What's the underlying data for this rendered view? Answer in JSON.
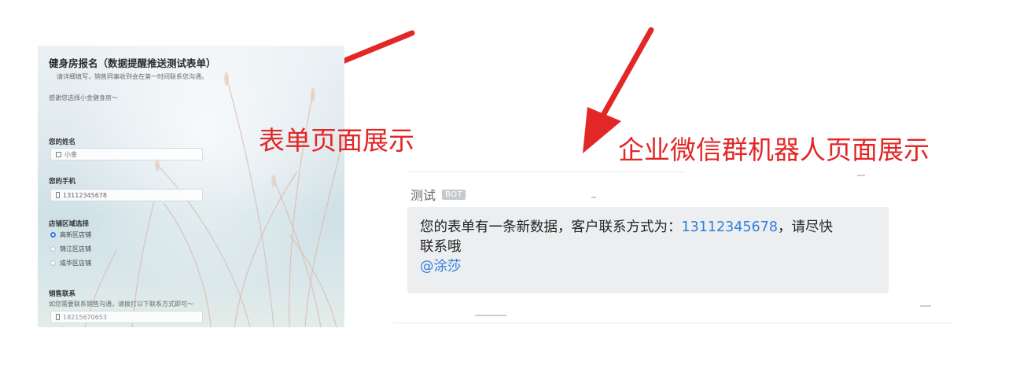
{
  "form": {
    "title": "健身房报名（数据提醒推送测试表单）",
    "description": "请详细填写，销售同事收到会在第一时间联系您沟通。",
    "thanks": "感谢您选择小金健身房～",
    "name_label": "您的姓名",
    "name_value": "小金",
    "phone_label": "您的手机",
    "phone_value": "13112345678",
    "store_label": "店铺区域选择",
    "store_options": [
      "高新区店铺",
      "锦江区店铺",
      "成华区店铺"
    ],
    "store_selected": "高新区店铺",
    "sales_label": "销售联系",
    "sales_hint": "如您需要联系销售沟通，请拨打以下联系方式即可～",
    "sales_phone": "18215670653"
  },
  "captions": {
    "form_caption": "表单页面展示",
    "bot_caption": "企业微信群机器人页面展示"
  },
  "chat": {
    "sender": "测试",
    "badge": "BOT",
    "message_prefix": "您的表单有一条新数据，客户联系方式为：",
    "message_phone": "13112345678",
    "message_suffix": "，请尽快",
    "message_line2": "联系哦",
    "mention": "@涂莎"
  },
  "colors": {
    "accent_red": "#e32626",
    "link_blue": "#2f7fdc",
    "bubble_bg": "#eceef0",
    "radio_selected": "#3a7bd5"
  }
}
